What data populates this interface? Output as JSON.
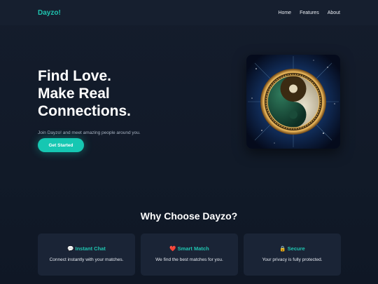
{
  "nav": {
    "brand": "Dayzo!",
    "links": [
      "Home",
      "Features",
      "About"
    ]
  },
  "hero": {
    "title_lines": [
      "Find Love.",
      "Make Real",
      "Connections."
    ],
    "subtitle": "Join Dayzo! and meet amazing people around you.",
    "cta_label": "Get Started",
    "image_alt": "yin-yang-emblem-image"
  },
  "features": {
    "heading": "Why Choose Dayzo?",
    "cards": [
      {
        "icon": "💬",
        "icon_name": "speech-bubble-icon",
        "title": "Instant Chat",
        "text": "Connect instantly with your matches."
      },
      {
        "icon": "❤️",
        "icon_name": "heart-icon",
        "title": "Smart Match",
        "text": "We find the best matches for you."
      },
      {
        "icon": "🔒",
        "icon_name": "lock-icon",
        "title": "Secure",
        "text": "Your privacy is fully protected."
      }
    ]
  },
  "colors": {
    "accent": "#1fc4b0",
    "background": "#141c2c",
    "card": "#1a2436"
  }
}
